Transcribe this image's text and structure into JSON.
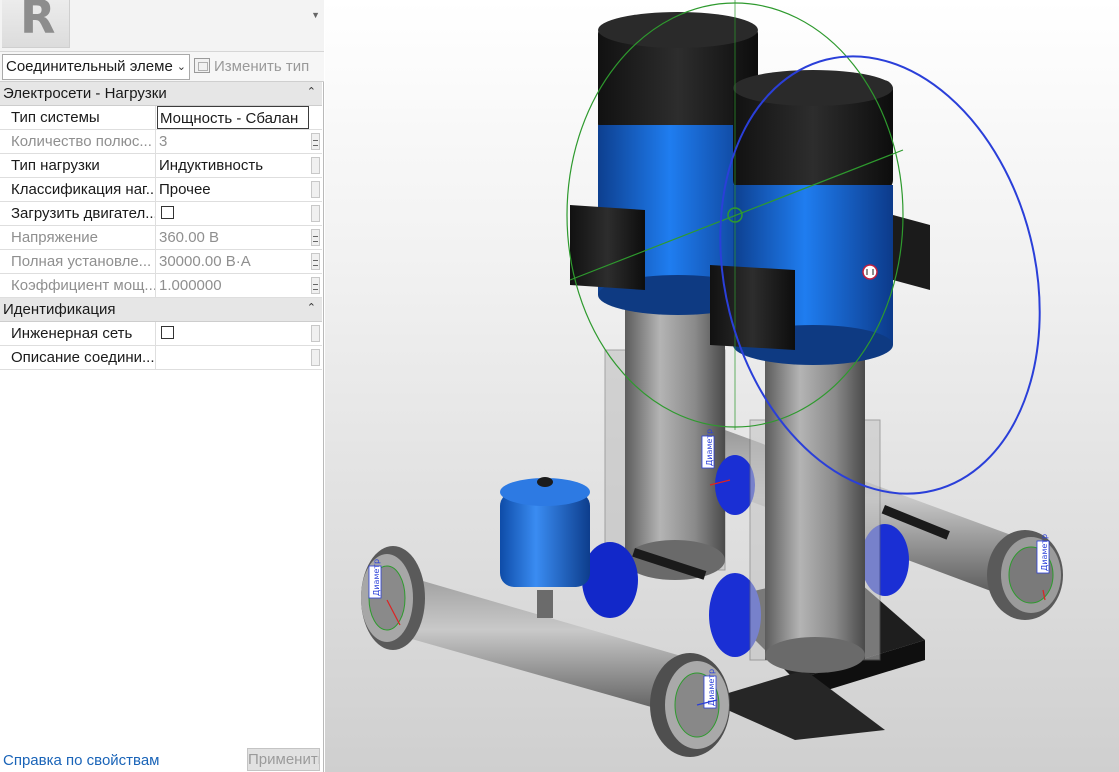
{
  "type_selector": {
    "value": "Соединительный элеме"
  },
  "edit_type": {
    "label": "Изменить тип"
  },
  "sections": {
    "electrical": {
      "title": "Электросети - Нагрузки"
    },
    "identity": {
      "title": "Идентификация"
    }
  },
  "properties": {
    "system_type": {
      "label": "Тип системы",
      "value": "Мощность - Сбалан"
    },
    "poles": {
      "label": "Количество полюс...",
      "value": "3"
    },
    "load_type": {
      "label": "Тип нагрузки",
      "value": "Индуктивность"
    },
    "load_class": {
      "label": "Классификация наг...",
      "value": "Прочее"
    },
    "motor": {
      "label": "Загрузить двигател..."
    },
    "voltage": {
      "label": "Напряжение",
      "value": "360.00 В"
    },
    "apparent_load": {
      "label": "Полная установле...",
      "value": "30000.00 В·А"
    },
    "power_factor": {
      "label": "Коэффициент мощ...",
      "value": "1.000000"
    },
    "network": {
      "label": "Инженерная сеть"
    },
    "description": {
      "label": "Описание соедини...",
      "value": ""
    }
  },
  "footer": {
    "help_link": "Справка по свойствам",
    "apply": "Применить"
  },
  "viewport": {
    "connector_label": "Диаметр",
    "colors": {
      "motor_blue": "#1769d6",
      "body_gray": "#8a8a8a",
      "dark": "#1c1c1c",
      "gizmo_green": "#2e9a2e",
      "gizmo_blue": "#2a3fd9"
    }
  }
}
